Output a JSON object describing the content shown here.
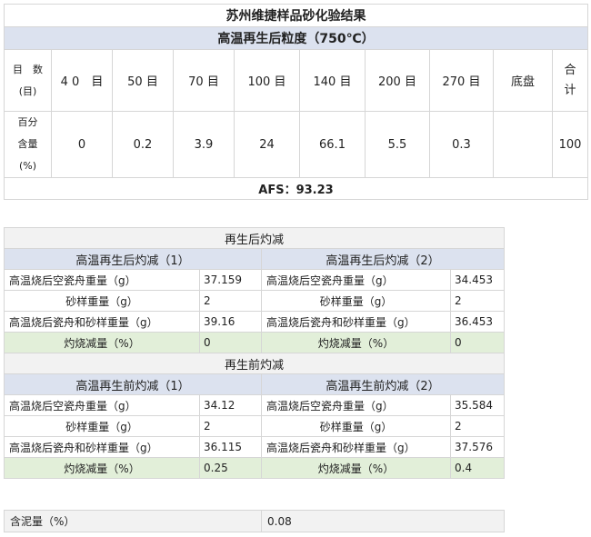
{
  "top": {
    "title": "苏州维捷样品砂化验结果",
    "subtitle": "高温再生后粒度（750℃）",
    "row1_label_a": "目　数",
    "row1_label_b": "(目)",
    "mesh": [
      "4 0　目",
      "50 目",
      "70 目",
      "100 目",
      "140 目",
      "200 目",
      "270 目",
      "底盘",
      "合",
      "计"
    ],
    "row2_label_a": "百分",
    "row2_label_b": "含量",
    "row2_label_c": "(%)",
    "percent": [
      "0",
      "0.2",
      "3.9",
      "24",
      "66.1",
      "5.5",
      "0.3",
      "",
      "100"
    ],
    "afs": "AFS：93.23"
  },
  "after": {
    "title": "再生后灼减",
    "left_head": "高温再生后灼减（1）",
    "right_head": "高温再生后灼减（2）",
    "rows": [
      {
        "l_label": "高温烧后空瓷舟重量（g）",
        "l_val": "37.159",
        "r_label": "高温烧后空瓷舟重量（g）",
        "r_val": "34.453"
      },
      {
        "l_label": "砂样重量（g）",
        "l_val": "2",
        "r_label": "砂样重量（g）",
        "r_val": "2"
      },
      {
        "l_label": "高温烧后瓷舟和砂样重量（g）",
        "l_val": "39.16",
        "r_label": "高温烧后瓷舟和砂样重量（g）",
        "r_val": "36.453"
      },
      {
        "l_label": "灼烧减量（%）",
        "l_val": "0",
        "r_label": "灼烧减量（%）",
        "r_val": "0"
      }
    ]
  },
  "before": {
    "title": "再生前灼减",
    "left_head": "高温再生前灼减（1）",
    "right_head": "高温再生前灼减（2）",
    "rows": [
      {
        "l_label": "高温烧后空瓷舟重量（g）",
        "l_val": "34.12",
        "r_label": "高温烧后空瓷舟重量（g）",
        "r_val": "35.584"
      },
      {
        "l_label": "砂样重量（g）",
        "l_val": "2",
        "r_label": "砂样重量（g）",
        "r_val": "2"
      },
      {
        "l_label": "高温烧后瓷舟和砂样重量（g）",
        "l_val": "36.115",
        "r_label": "高温烧后瓷舟和砂样重量（g）",
        "r_val": "37.576"
      },
      {
        "l_label": "灼烧减量（%）",
        "l_val": "0.25",
        "r_label": "灼烧减量（%）",
        "r_val": "0.4"
      }
    ]
  },
  "mud": {
    "label": "含泥量（%）",
    "value": "0.08"
  },
  "colors": {
    "header_blue": "#dce2ef",
    "section_gray": "#f2f2f2",
    "result_green": "#e2efd9",
    "grid": "#d6d6d6"
  }
}
